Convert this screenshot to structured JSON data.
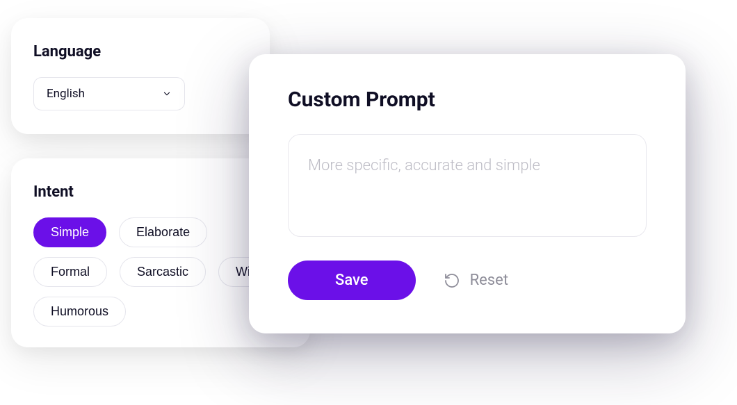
{
  "language": {
    "title": "Language",
    "selected": "English"
  },
  "intent": {
    "title": "Intent",
    "options": [
      {
        "label": "Simple",
        "active": true
      },
      {
        "label": "Elaborate",
        "active": false
      },
      {
        "label": "Formal",
        "active": false
      },
      {
        "label": "Sarcastic",
        "active": false
      },
      {
        "label": "Witty",
        "active": false
      },
      {
        "label": "Humorous",
        "active": false
      }
    ]
  },
  "prompt": {
    "title": "Custom Prompt",
    "placeholder": "More specific, accurate and simple",
    "save_label": "Save",
    "reset_label": "Reset"
  },
  "colors": {
    "accent": "#6b10e8",
    "text": "#0f0e24",
    "muted": "#8e8d99",
    "border": "#e5e5ec"
  }
}
